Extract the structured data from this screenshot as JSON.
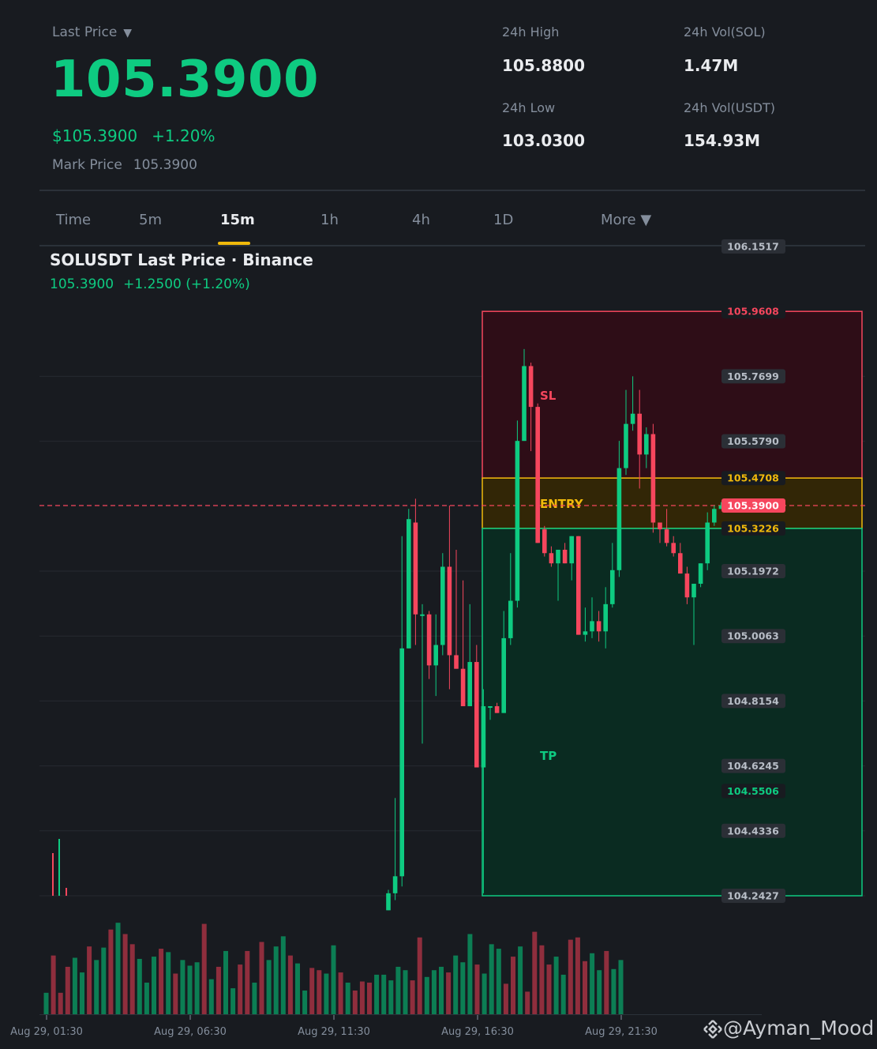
{
  "header": {
    "last_price_label": "Last Price",
    "last_price_caret": "▼",
    "last_price": "105.3900",
    "usd_price": "$105.3900",
    "change_pct": "+1.20%",
    "mark_price_label": "Mark Price",
    "mark_price": "105.3900"
  },
  "stats": {
    "high_label": "24h High",
    "high_value": "105.8800",
    "low_label": "24h Low",
    "low_value": "103.0300",
    "vol_sol_label": "24h Vol(SOL)",
    "vol_sol_value": "1.47M",
    "vol_usdt_label": "24h Vol(USDT)",
    "vol_usdt_value": "154.93M"
  },
  "tabs": [
    {
      "label": "Time",
      "active": false
    },
    {
      "label": "5m",
      "active": false
    },
    {
      "label": "15m",
      "active": true
    },
    {
      "label": "1h",
      "active": false
    },
    {
      "label": "4h",
      "active": false
    },
    {
      "label": "1D",
      "active": false
    },
    {
      "label": "More ▼",
      "active": false
    }
  ],
  "chart": {
    "title": "SOLUSDT Last Price · Binance",
    "sub_price": "105.3900",
    "sub_change": "+1.2500 (+1.20%)",
    "zone_labels": {
      "sl": "SL",
      "entry": "ENTRY",
      "tp": "TP"
    },
    "watermark": "@Ayman_Mood",
    "colors": {
      "up": "#0ecb81",
      "down": "#f6465d",
      "accent": "#f0b90b",
      "bg": "#181b20",
      "grid": "#2b3139"
    }
  },
  "chart_data": {
    "type": "candlestick",
    "symbol": "SOLUSDT",
    "interval": "15m",
    "ylim": [
      104.2427,
      106.1517
    ],
    "y_ticks": [
      "106.1517",
      "105.7699",
      "105.5790",
      "105.1972",
      "105.0063",
      "104.8154",
      "104.6245",
      "104.4336",
      "104.2427"
    ],
    "x_ticks": [
      "Aug 29, 01:30",
      "Aug 29, 06:30",
      "Aug 29, 11:30",
      "Aug 29, 16:30",
      "Aug 29, 21:30"
    ],
    "position": {
      "stop_loss": "105.9608",
      "entry_top": "105.4708",
      "entry_bottom": "105.3226",
      "take_profit": "104.5506",
      "last_price": "105.3900"
    },
    "candles": [
      {
        "o": 104.2,
        "h": 104.26,
        "l": 104.2,
        "c": 104.25
      },
      {
        "o": 104.25,
        "h": 104.53,
        "l": 104.23,
        "c": 104.3
      },
      {
        "o": 104.3,
        "h": 105.3,
        "l": 104.27,
        "c": 104.97
      },
      {
        "o": 104.97,
        "h": 105.38,
        "l": 104.97,
        "c": 105.35
      },
      {
        "o": 105.34,
        "h": 105.41,
        "l": 104.98,
        "c": 105.07
      },
      {
        "o": 105.07,
        "h": 105.1,
        "l": 104.69,
        "c": 105.07
      },
      {
        "o": 105.07,
        "h": 105.08,
        "l": 104.88,
        "c": 104.92
      },
      {
        "o": 104.92,
        "h": 105.07,
        "l": 104.83,
        "c": 104.98
      },
      {
        "o": 104.98,
        "h": 105.25,
        "l": 104.95,
        "c": 105.21
      },
      {
        "o": 105.21,
        "h": 105.39,
        "l": 104.85,
        "c": 104.95
      },
      {
        "o": 104.95,
        "h": 105.26,
        "l": 104.94,
        "c": 104.91
      },
      {
        "o": 104.91,
        "h": 105.17,
        "l": 104.83,
        "c": 104.8
      },
      {
        "o": 104.8,
        "h": 105.1,
        "l": 104.87,
        "c": 104.93
      },
      {
        "o": 104.93,
        "h": 104.98,
        "l": 104.62,
        "c": 104.62
      },
      {
        "o": 104.62,
        "h": 104.85,
        "l": 104.25,
        "c": 104.8
      },
      {
        "o": 104.8,
        "h": 104.77,
        "l": 104.76,
        "c": 104.8
      },
      {
        "o": 104.8,
        "h": 104.81,
        "l": 104.78,
        "c": 104.78
      },
      {
        "o": 104.78,
        "h": 105.08,
        "l": 104.78,
        "c": 105.0
      },
      {
        "o": 105.0,
        "h": 105.25,
        "l": 104.98,
        "c": 105.11
      },
      {
        "o": 105.11,
        "h": 105.64,
        "l": 105.09,
        "c": 105.58
      },
      {
        "o": 105.58,
        "h": 105.85,
        "l": 105.58,
        "c": 105.8
      },
      {
        "o": 105.8,
        "h": 105.81,
        "l": 105.55,
        "c": 105.68
      },
      {
        "o": 105.68,
        "h": 105.69,
        "l": 105.28,
        "c": 105.28
      },
      {
        "o": 105.32,
        "h": 105.33,
        "l": 105.24,
        "c": 105.25
      },
      {
        "o": 105.25,
        "h": 105.27,
        "l": 105.21,
        "c": 105.22
      },
      {
        "o": 105.22,
        "h": 105.26,
        "l": 105.11,
        "c": 105.26
      },
      {
        "o": 105.26,
        "h": 105.28,
        "l": 105.22,
        "c": 105.22
      },
      {
        "o": 105.22,
        "h": 105.3,
        "l": 105.17,
        "c": 105.3
      },
      {
        "o": 105.3,
        "h": 105.3,
        "l": 105.01,
        "c": 105.01
      },
      {
        "o": 105.01,
        "h": 105.09,
        "l": 104.99,
        "c": 105.02
      },
      {
        "o": 105.02,
        "h": 105.12,
        "l": 105.0,
        "c": 105.05
      },
      {
        "o": 105.05,
        "h": 105.08,
        "l": 104.99,
        "c": 105.02
      },
      {
        "o": 105.02,
        "h": 105.15,
        "l": 104.97,
        "c": 105.1
      },
      {
        "o": 105.1,
        "h": 105.28,
        "l": 105.09,
        "c": 105.2
      },
      {
        "o": 105.2,
        "h": 105.58,
        "l": 105.18,
        "c": 105.5
      },
      {
        "o": 105.5,
        "h": 105.73,
        "l": 105.48,
        "c": 105.63
      },
      {
        "o": 105.63,
        "h": 105.77,
        "l": 105.61,
        "c": 105.66
      },
      {
        "o": 105.66,
        "h": 105.73,
        "l": 105.44,
        "c": 105.54
      },
      {
        "o": 105.54,
        "h": 105.62,
        "l": 105.5,
        "c": 105.6
      },
      {
        "o": 105.6,
        "h": 105.63,
        "l": 105.31,
        "c": 105.34
      },
      {
        "o": 105.34,
        "h": 105.34,
        "l": 105.28,
        "c": 105.32
      },
      {
        "o": 105.32,
        "h": 105.38,
        "l": 105.27,
        "c": 105.28
      },
      {
        "o": 105.28,
        "h": 105.3,
        "l": 105.24,
        "c": 105.25
      },
      {
        "o": 105.25,
        "h": 105.28,
        "l": 105.19,
        "c": 105.19
      },
      {
        "o": 105.19,
        "h": 105.21,
        "l": 105.1,
        "c": 105.12
      },
      {
        "o": 105.12,
        "h": 105.16,
        "l": 104.98,
        "c": 105.16
      },
      {
        "o": 105.16,
        "h": 105.22,
        "l": 105.15,
        "c": 105.22
      },
      {
        "o": 105.22,
        "h": 105.37,
        "l": 105.2,
        "c": 105.34
      },
      {
        "o": 105.34,
        "h": 105.39,
        "l": 105.33,
        "c": 105.38
      },
      {
        "o": 105.38,
        "h": 105.4,
        "l": 105.38,
        "c": 105.39
      }
    ],
    "volumes": [
      0.19,
      0.52,
      0.19,
      0.42,
      0.5,
      0.37,
      0.6,
      0.48,
      0.59,
      0.75,
      0.81,
      0.71,
      0.62,
      0.49,
      0.28,
      0.51,
      0.58,
      0.55,
      0.36,
      0.48,
      0.43,
      0.46,
      0.8,
      0.31,
      0.42,
      0.56,
      0.23,
      0.44,
      0.56,
      0.28,
      0.64,
      0.48,
      0.6,
      0.69,
      0.52,
      0.45,
      0.21,
      0.41,
      0.39,
      0.36,
      0.61,
      0.37,
      0.28,
      0.21,
      0.29,
      0.28,
      0.35,
      0.35,
      0.3,
      0.42,
      0.39,
      0.3,
      0.68,
      0.33,
      0.39,
      0.42,
      0.37,
      0.52,
      0.46,
      0.71,
      0.44,
      0.36,
      0.62,
      0.58,
      0.27,
      0.51,
      0.6,
      0.2,
      0.73,
      0.61,
      0.44,
      0.51,
      0.35,
      0.66,
      0.68,
      0.47,
      0.54,
      0.39,
      0.56,
      0.4,
      0.48
    ],
    "volume_colors": [
      "up",
      "down",
      "down",
      "down",
      "up",
      "up",
      "down",
      "up",
      "up",
      "down",
      "up",
      "down",
      "down",
      "up",
      "up",
      "up",
      "down",
      "up",
      "down",
      "up",
      "up",
      "up",
      "down",
      "up",
      "down",
      "up",
      "up",
      "down",
      "down",
      "up",
      "down",
      "up",
      "up",
      "up",
      "down",
      "up",
      "up",
      "down",
      "down",
      "up",
      "up",
      "down",
      "up",
      "down",
      "down",
      "down",
      "up",
      "up",
      "up",
      "up",
      "up",
      "down",
      "down",
      "up",
      "up",
      "up",
      "down",
      "up",
      "up",
      "up",
      "down",
      "up",
      "up",
      "up",
      "down",
      "down",
      "up",
      "down",
      "down",
      "down",
      "down",
      "up",
      "up",
      "down",
      "down",
      "down",
      "up",
      "up",
      "down",
      "up",
      "up"
    ]
  }
}
